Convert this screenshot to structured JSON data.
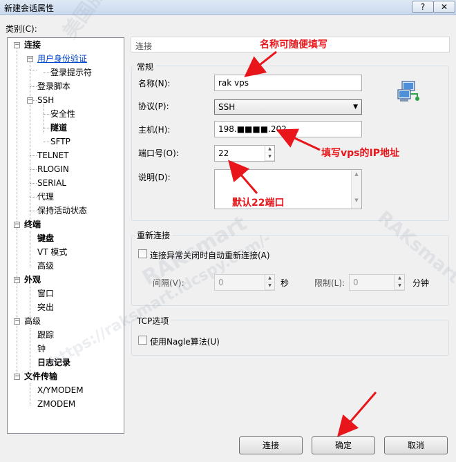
{
  "window": {
    "title": "新建会话属性",
    "help_label": "?",
    "close_label": "✕"
  },
  "category_label": "类别(C):",
  "tree": [
    {
      "label": "连接",
      "bold": true
    },
    {
      "label": "用户身份验证",
      "selected": true
    },
    {
      "label": "登录提示符"
    },
    {
      "label": "登录脚本"
    },
    {
      "label": "SSH"
    },
    {
      "label": "安全性"
    },
    {
      "label": "隧道",
      "bold": true
    },
    {
      "label": "SFTP"
    },
    {
      "label": "TELNET"
    },
    {
      "label": "RLOGIN"
    },
    {
      "label": "SERIAL"
    },
    {
      "label": "代理"
    },
    {
      "label": "保持活动状态"
    },
    {
      "label": "终端",
      "bold": true
    },
    {
      "label": "键盘",
      "bold": true
    },
    {
      "label": "VT 模式"
    },
    {
      "label": "高级"
    },
    {
      "label": "外观",
      "bold": true
    },
    {
      "label": "窗口"
    },
    {
      "label": "突出"
    },
    {
      "label": "高级"
    },
    {
      "label": "跟踪"
    },
    {
      "label": "钟"
    },
    {
      "label": "日志记录",
      "bold": true
    },
    {
      "label": "文件传输",
      "bold": true
    },
    {
      "label": "X/YMODEM"
    },
    {
      "label": "ZMODEM"
    }
  ],
  "panel_header": "连接",
  "general": {
    "title": "常规",
    "name_label": "名称(N):",
    "name_value": "rak vps",
    "protocol_label": "协议(P):",
    "protocol_value": "SSH",
    "host_label": "主机(H):",
    "host_value": "198.■■■■.202",
    "port_label": "端口号(O):",
    "port_value": "22",
    "desc_label": "说明(D):",
    "desc_value": ""
  },
  "reconnect": {
    "title": "重新连接",
    "auto_reconnect_label": "连接异常关闭时自动重新连接(A)",
    "interval_label": "间隔(V):",
    "interval_value": "0",
    "interval_unit": "秒",
    "limit_label": "限制(L):",
    "limit_value": "0",
    "limit_unit": "分钟"
  },
  "tcp": {
    "title": "TCP选项",
    "nagle_label": "使用Nagle算法(U)"
  },
  "buttons": {
    "connect": "连接",
    "ok": "确定",
    "cancel": "取消"
  },
  "annotations": {
    "name_hint": "名称可随便填写",
    "ip_hint": "填写vps的IP地址",
    "port_hint": "默认22端口"
  },
  "watermarks": [
    "美国服务器评测",
    "RAKsmart",
    "-https://raksmart.idcspy.com/-"
  ],
  "colors": {
    "annotation": "#e8151a",
    "selected_tree": "#0046c8"
  },
  "icons": {
    "network": "network-computers-icon"
  }
}
